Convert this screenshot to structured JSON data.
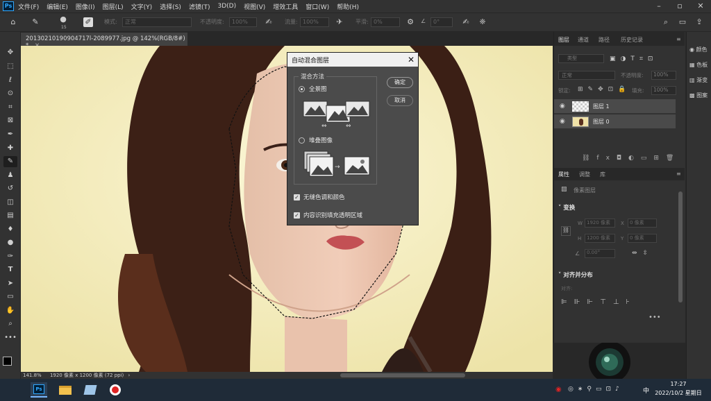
{
  "app": {
    "logo": "Ps"
  },
  "menubar": {
    "items": [
      "文件(F)",
      "编辑(E)",
      "图像(I)",
      "图层(L)",
      "文字(Y)",
      "选择(S)",
      "滤镜(T)",
      "3D(D)",
      "视图(V)",
      "增效工具",
      "窗口(W)",
      "帮助(H)"
    ]
  },
  "options": {
    "brush_size": "15",
    "mode_label": "模式:",
    "mode_value": "正常",
    "opacity_label": "不透明度:",
    "opacity_value": "100%",
    "flow_label": "流量:",
    "flow_value": "100%",
    "smooth_label": "平滑:",
    "smooth_value": "0%",
    "angle_value": "0°"
  },
  "document": {
    "tab_title": "20130210190904717l-2089977.jpg @ 142%(RGB/8#) *"
  },
  "statusbar": {
    "zoom": "141.8%",
    "info": "1920 像素 x 1200 像素 (72 ppi)"
  },
  "dialog": {
    "title": "自动混合图层",
    "group_label": "混合方法",
    "option_panorama": "全景图",
    "option_stack": "堆叠图像",
    "checkbox_tone": "无缝色调和颜色",
    "checkbox_fill": "内容识别填充透明区域",
    "ok_label": "确定",
    "cancel_label": "取消",
    "selected": "全景图"
  },
  "layers_panel": {
    "tabs": [
      "图层",
      "通道",
      "路径",
      "历史记录"
    ],
    "filter_placeholder": "类型",
    "blend_mode": "正常",
    "opacity_label": "不透明度:",
    "opacity_value": "100%",
    "lock_label": "锁定:",
    "fill_label": "填充:",
    "fill_value": "100%",
    "layers": [
      {
        "name": "图层 1"
      },
      {
        "name": "图层 0"
      }
    ]
  },
  "properties_panel": {
    "tabs": [
      "属性",
      "调整",
      "库"
    ],
    "pixel_layer": "像素图层",
    "transform_title": "变换",
    "w_label": "W",
    "w_value": "1920 像素",
    "h_label": "H",
    "h_value": "1200 像素",
    "x_label": "X",
    "x_value": "0 像素",
    "y_label": "Y",
    "y_value": "0 像素",
    "angle_value": "0.00°",
    "align_title": "对齐并分布",
    "align_label": "对齐:"
  },
  "far_panel": {
    "items": [
      "颜色",
      "色板",
      "渐变",
      "图案"
    ]
  },
  "taskbar": {
    "time": "17:27",
    "date": "2022/10/2 星期日",
    "ime": "中"
  },
  "colors": {
    "accent": "#31a8ff",
    "panel": "#323232",
    "dialog": "#4b4b4b"
  }
}
